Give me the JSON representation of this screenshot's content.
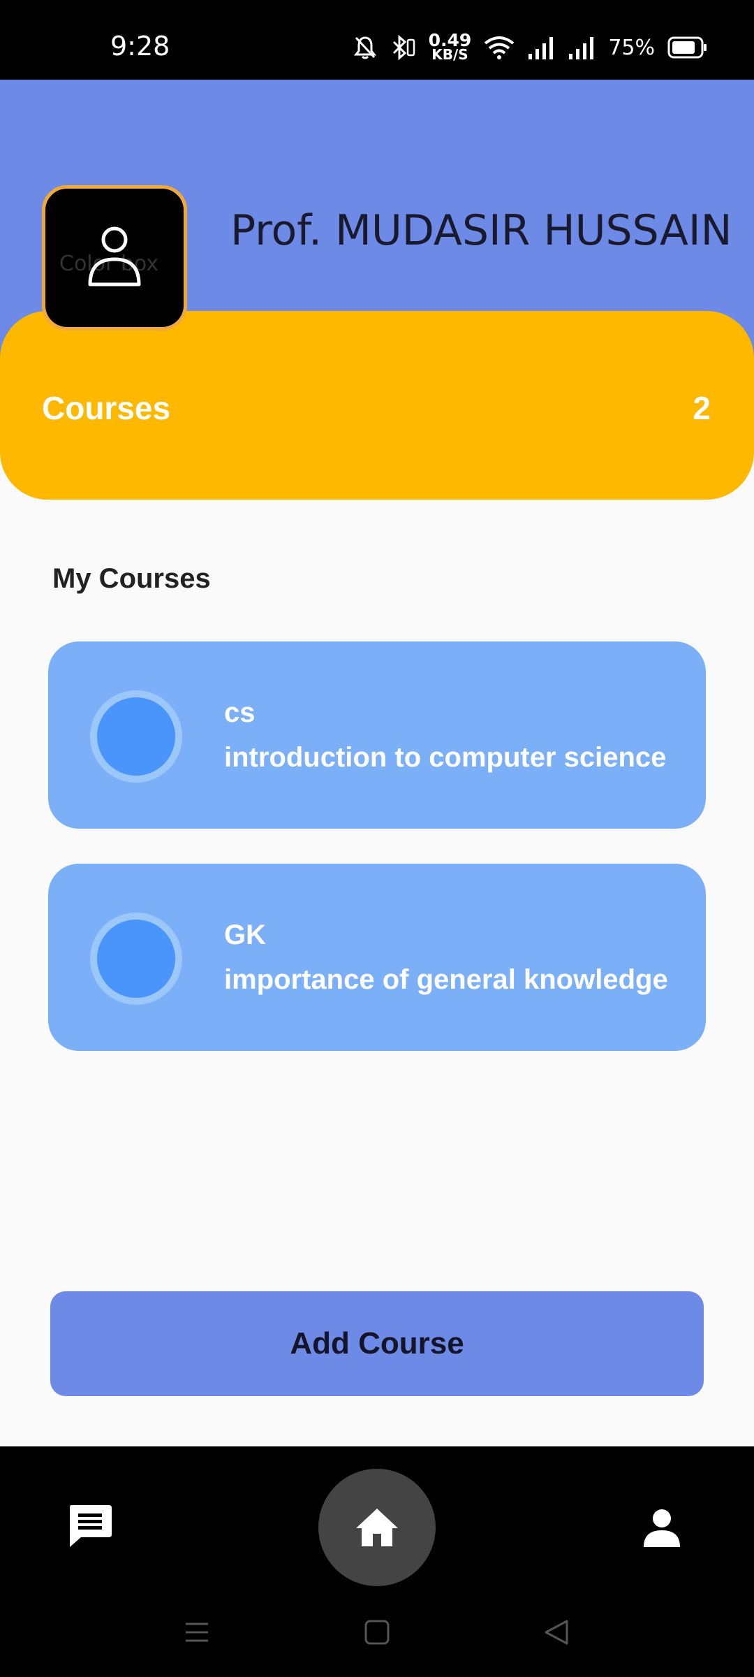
{
  "status_bar": {
    "time": "9:28",
    "net_speed_value": "0.49",
    "net_speed_unit": "KB/S",
    "battery_percent": "75%",
    "icons": [
      "bell-muted-icon",
      "bluetooth-icon",
      "wifi-icon",
      "signal-icon",
      "signal-icon",
      "battery-icon"
    ]
  },
  "header": {
    "avatar_icon": "person-icon",
    "avatar_watermark": "Color box",
    "name": "Prof. MUDASIR HUSSAIN",
    "background_color": "#6c8ae6"
  },
  "summary": {
    "label": "Courses",
    "count": "2",
    "color": "#ffb800"
  },
  "section": {
    "title": "My Courses"
  },
  "courses": [
    {
      "code": "cs",
      "description": "introduction to computer science"
    },
    {
      "code": "GK",
      "description": "importance of general knowledge"
    }
  ],
  "actions": {
    "add_course_label": "Add Course"
  },
  "bottom_nav": {
    "items": [
      "chat-icon",
      "home-icon",
      "profile-icon"
    ]
  },
  "system_nav": [
    "menu-icon",
    "square-home-icon",
    "back-icon"
  ]
}
